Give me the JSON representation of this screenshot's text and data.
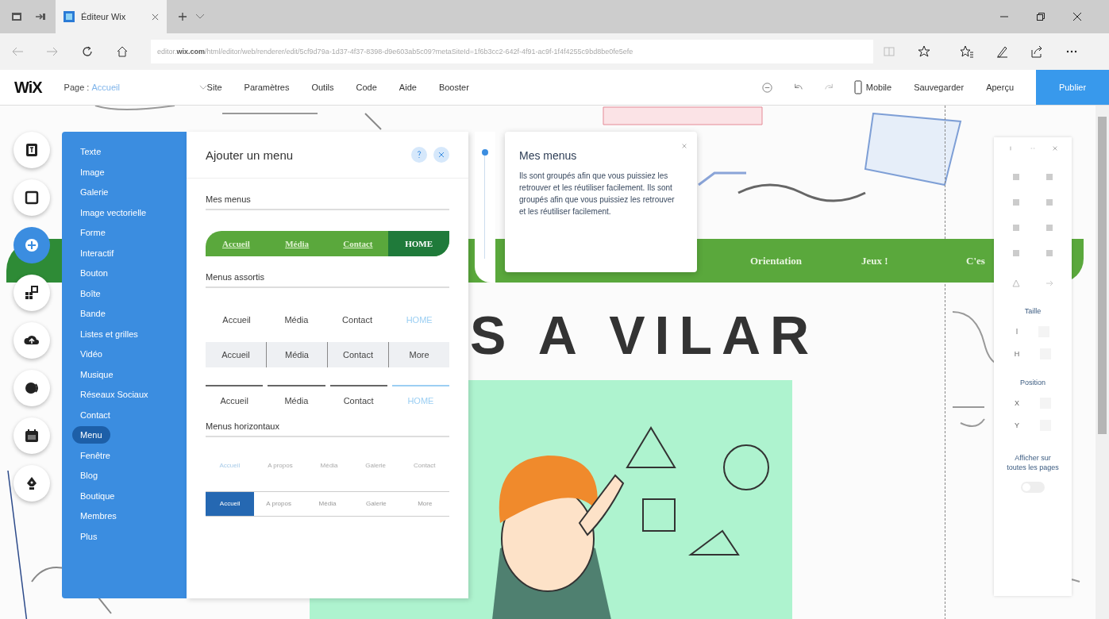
{
  "browser": {
    "tab_title": "Éditeur Wix",
    "url_host": "editor.wix.com",
    "url_path": "/html/editor/web/renderer/edit/5cf9d79a-1d37-4f37-8398-d9e603ab5c09?metaSiteId=1f6b3cc2-642f-4f91-ac9f-1f4f4255c9bd8be0fe5efe"
  },
  "wix_bar": {
    "logo": "WiX",
    "page_label": "Page :",
    "page_name": "Accueil",
    "menus": [
      "Site",
      "Paramètres",
      "Outils",
      "Code",
      "Aide",
      "Booster"
    ],
    "mobile": "Mobile",
    "save": "Sauvegarder",
    "preview": "Aperçu",
    "publish": "Publier"
  },
  "tools": [
    {
      "kind": "text",
      "selected": false
    },
    {
      "kind": "square",
      "selected": false
    },
    {
      "kind": "add",
      "selected": true
    },
    {
      "kind": "apps",
      "selected": false
    },
    {
      "kind": "upload",
      "selected": false
    },
    {
      "kind": "chat",
      "selected": false
    },
    {
      "kind": "calendar",
      "selected": false
    },
    {
      "kind": "pen",
      "selected": false
    }
  ],
  "categories": [
    {
      "label": "Texte",
      "selected": false
    },
    {
      "label": "Image",
      "selected": false
    },
    {
      "label": "Galerie",
      "selected": false
    },
    {
      "label": "Image vectorielle",
      "selected": false
    },
    {
      "label": "Forme",
      "selected": false
    },
    {
      "label": "Interactif",
      "selected": false
    },
    {
      "label": "Bouton",
      "selected": false
    },
    {
      "label": "Boîte",
      "selected": false
    },
    {
      "label": "Bande",
      "selected": false
    },
    {
      "label": "Listes et grilles",
      "selected": false
    },
    {
      "label": "Vidéo",
      "selected": false
    },
    {
      "label": "Musique",
      "selected": false
    },
    {
      "label": "Réseaux Sociaux",
      "selected": false
    },
    {
      "label": "Contact",
      "selected": false
    },
    {
      "label": "Menu",
      "selected": true
    },
    {
      "label": "Fenêtre",
      "selected": false
    },
    {
      "label": "Blog",
      "selected": false
    },
    {
      "label": "Boutique",
      "selected": false
    },
    {
      "label": "Membres",
      "selected": false
    },
    {
      "label": "Plus",
      "selected": false
    }
  ],
  "panel": {
    "title": "Ajouter un menu",
    "sections": [
      {
        "title": "Mes menus",
        "presets": [
          {
            "kind": "green",
            "items": [
              {
                "label": "Accueil",
                "selected": false
              },
              {
                "label": "Média",
                "selected": false
              },
              {
                "label": "Contact",
                "selected": false
              },
              {
                "label": "HOME",
                "selected": true
              }
            ]
          }
        ]
      },
      {
        "title": "Menus assortis",
        "presets": [
          {
            "kind": "plain",
            "items": [
              {
                "label": "Accueil",
                "selected": false
              },
              {
                "label": "Média",
                "selected": false
              },
              {
                "label": "Contact",
                "selected": false
              },
              {
                "label": "HOME",
                "selected": true
              }
            ]
          },
          {
            "kind": "tabs",
            "items": [
              {
                "label": "Accueil",
                "selected": false
              },
              {
                "label": "Média",
                "selected": false
              },
              {
                "label": "Contact",
                "selected": false
              },
              {
                "label": "More",
                "selected": false
              }
            ]
          },
          {
            "kind": "underline",
            "items": [
              {
                "label": "Accueil",
                "selected": false
              },
              {
                "label": "Média",
                "selected": false
              },
              {
                "label": "Contact",
                "selected": false
              },
              {
                "label": "HOME",
                "selected": true
              }
            ]
          }
        ]
      },
      {
        "title": "Menus horizontaux",
        "presets": [
          {
            "kind": "small",
            "items": [
              {
                "label": "Accueil",
                "selected": true
              },
              {
                "label": "A propos",
                "selected": false
              },
              {
                "label": "Média",
                "selected": false
              },
              {
                "label": "Galerie",
                "selected": false
              },
              {
                "label": "Contact",
                "selected": false
              }
            ]
          },
          {
            "kind": "bar",
            "items": [
              {
                "label": "Accueil",
                "selected": true
              },
              {
                "label": "A propos",
                "selected": false
              },
              {
                "label": "Média",
                "selected": false
              },
              {
                "label": "Galerie",
                "selected": false
              },
              {
                "label": "More",
                "selected": false
              }
            ]
          }
        ]
      }
    ]
  },
  "tooltip": {
    "title": "Mes menus",
    "body": "Ils sont groupés afin que vous puissiez les retrouver et les réutiliser facilement. Ils sont groupés afin que vous puissiez les retrouver et les réutiliser facilement."
  },
  "site": {
    "nav": [
      "Orientation",
      "Jeux !",
      "C'es"
    ],
    "heading": "S A VILAR"
  },
  "right_panel": {
    "size_label": "Taille",
    "size_fields": [
      "l",
      "H"
    ],
    "position_label": "Position",
    "position_fields": [
      "X",
      "Y"
    ],
    "show_all_label": "Afficher sur toutes les pages",
    "show_all_on": false
  }
}
